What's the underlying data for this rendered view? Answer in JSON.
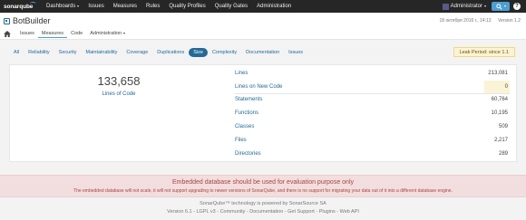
{
  "topbar": {
    "logo": "sonarqube",
    "nav": [
      {
        "label": "Dashboards",
        "dropdown": true
      },
      {
        "label": "Issues",
        "dropdown": false
      },
      {
        "label": "Measures",
        "dropdown": false
      },
      {
        "label": "Rules",
        "dropdown": false
      },
      {
        "label": "Quality Profiles",
        "dropdown": false
      },
      {
        "label": "Quality Gates",
        "dropdown": false
      },
      {
        "label": "Administration",
        "dropdown": false
      }
    ],
    "user": "Administrator",
    "search_icon": "search-icon",
    "help": "?"
  },
  "project": {
    "name": "BotBuilder",
    "date": "18 октября 2016 г., 14:13",
    "version": "Version 1.2",
    "tabs": [
      {
        "label": "Issues"
      },
      {
        "label": "Measures"
      },
      {
        "label": "Code"
      },
      {
        "label": "Administration"
      }
    ]
  },
  "measure_tabs": [
    "All",
    "Reliability",
    "Security",
    "Maintainability",
    "Coverage",
    "Duplications",
    "Size",
    "Complexity",
    "Documentation",
    "Issues"
  ],
  "active_measure_tab": "Size",
  "leak_period": "Leak Period: since 1.1",
  "main_metric": {
    "value": "133,658",
    "label": "Lines of Code"
  },
  "metrics": [
    {
      "label": "Lines",
      "value": "213,081",
      "leak": false
    },
    {
      "label": "Lines on New Code",
      "value": "0",
      "leak": true
    },
    {
      "label": "Statements",
      "value": "60,764",
      "leak": false
    },
    {
      "label": "Functions",
      "value": "10,195",
      "leak": false
    },
    {
      "label": "Classes",
      "value": "509",
      "leak": false
    },
    {
      "label": "Files",
      "value": "2,217",
      "leak": false
    },
    {
      "label": "Directories",
      "value": "289",
      "leak": false
    }
  ],
  "warning": {
    "title": "Embedded database should be used for evaluation purpose only",
    "text": "The embedded database will not scale, it will not support upgrading to newer versions of SonarQube, and there is no support for migrating your data out of it into a different database engine."
  },
  "footer": {
    "line1": "SonarQube™ technology is powered by SonarSource SA",
    "line2": "Version 6.1 - LGPL v3 - Community - Documentation - Get Support - Plugins - Web API"
  },
  "colors": {
    "accent": "#236a97",
    "navbar": "#262626",
    "leak": "#fbf3d5",
    "warning_bg": "#f2dede"
  }
}
